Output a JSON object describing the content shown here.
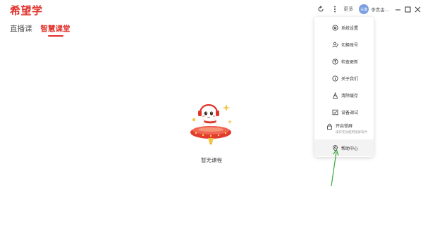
{
  "app": {
    "logo_text": "希望学"
  },
  "tabs": [
    {
      "label": "直播课",
      "active": false
    },
    {
      "label": "智慧课堂",
      "active": true
    }
  ],
  "toolbar": {
    "more_label": "更多",
    "avatar_text": "头像",
    "username": "李贵由..."
  },
  "menu": {
    "items": [
      {
        "label": "系统设置",
        "icon": "gear-icon"
      },
      {
        "label": "切换账号",
        "icon": "user-switch-icon"
      },
      {
        "label": "检查更新",
        "icon": "update-icon"
      },
      {
        "label": "关于我们",
        "icon": "info-icon"
      },
      {
        "label": "清除缓存",
        "icon": "broom-icon"
      },
      {
        "label": "设备调试",
        "icon": "device-check-icon"
      },
      {
        "label": "开启锁屏",
        "sublabel": "操作无效使用锁屏软件",
        "icon": "lock-icon"
      },
      {
        "label": "帮助中心",
        "icon": "location-pin-icon"
      }
    ]
  },
  "empty_state": {
    "text": "暂无课程"
  },
  "colors": {
    "brand": "#e0312a",
    "annotation_arrow": "#3aa83a"
  }
}
